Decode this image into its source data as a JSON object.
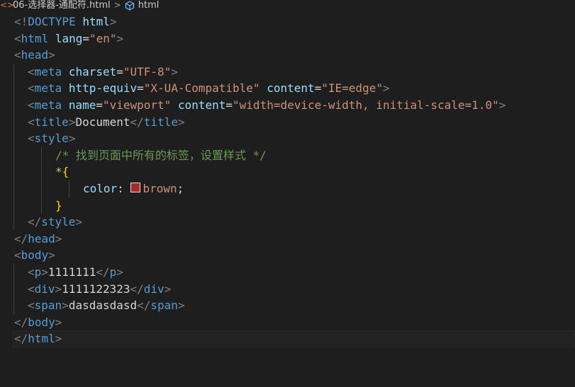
{
  "breadcrumb": {
    "file_icon": "<>",
    "file_name": "06-选择器-通配符.html",
    "separator": ">",
    "symbol_name": "html"
  },
  "code": {
    "doctype_open": "<!",
    "doctype_kw": "DOCTYPE",
    "doctype_html": " html",
    "doctype_close": ">",
    "html_tag": "html",
    "lang_attr": "lang",
    "lang_val": "\"en\"",
    "head_tag": "head",
    "meta_tag": "meta",
    "charset_attr": "charset",
    "charset_val": "\"UTF-8\"",
    "http_equiv_attr": "http-equiv",
    "http_equiv_val": "\"X-UA-Compatible\"",
    "content_attr": "content",
    "ie_val": "\"IE=edge\"",
    "name_attr": "name",
    "viewport_val": "\"viewport\"",
    "viewport_content_val": "\"width=device-width, initial-scale=1.0\"",
    "title_tag": "title",
    "title_text": "Document",
    "style_tag": "style",
    "comment": "/* 找到页面中所有的标签，设置样式 */",
    "selector": "*",
    "brace_open": "{",
    "property": "color",
    "colon": ": ",
    "value": "brown",
    "semicolon": ";",
    "brace_close": "}",
    "body_tag": "body",
    "p_tag": "p",
    "p_text": "1111111",
    "div_tag": "div",
    "div_text": "1111122323",
    "span_tag": "span",
    "span_text": "dasdasdasd",
    "swatch_color": "#a52a2a"
  }
}
